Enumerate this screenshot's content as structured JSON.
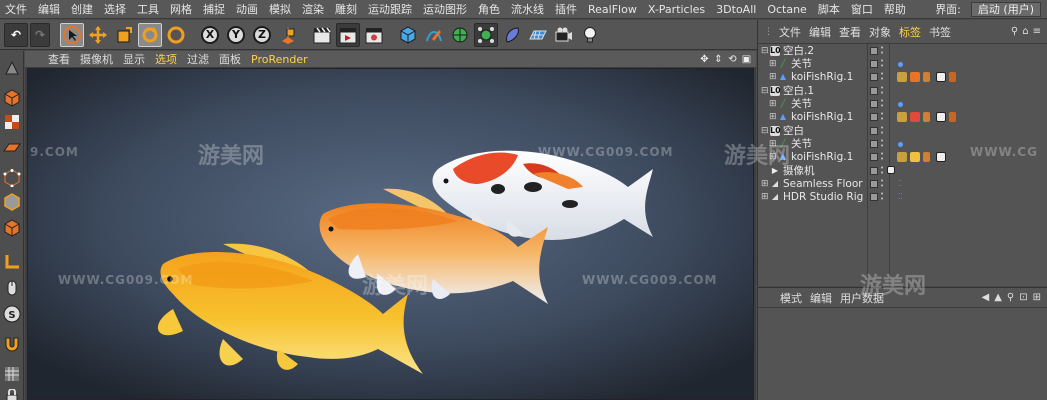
{
  "menubar": {
    "items": [
      "文件",
      "编辑",
      "创建",
      "选择",
      "工具",
      "网格",
      "捕捉",
      "动画",
      "模拟",
      "渲染",
      "雕刻",
      "运动跟踪",
      "运动图形",
      "角色",
      "流水线",
      "插件",
      "RealFlow",
      "X-Particles",
      "3DtoAll",
      "Octane",
      "脚本",
      "窗口",
      "帮助"
    ],
    "layout_label": "界面:",
    "layout_value": "启动 (用户)"
  },
  "toolbar": {
    "axis_x": "X",
    "axis_y": "Y",
    "axis_z": "Z"
  },
  "viewport": {
    "menu": [
      "查看",
      "摄像机",
      "显示",
      "选项",
      "过滤",
      "面板"
    ],
    "renderer": "ProRender"
  },
  "object_manager": {
    "tabs": [
      "文件",
      "编辑",
      "查看",
      "对象",
      "标签",
      "书签"
    ],
    "rows": [
      {
        "name": "空白.2"
      },
      {
        "name": "关节"
      },
      {
        "name": "koiFishRig.1"
      },
      {
        "name": "空白.1"
      },
      {
        "name": "关节"
      },
      {
        "name": "koiFishRig.1"
      },
      {
        "name": "空白"
      },
      {
        "name": "关节"
      },
      {
        "name": "koiFishRig.1"
      },
      {
        "name": "摄像机"
      },
      {
        "name": "Seamless Floor"
      },
      {
        "name": "HDR Studio Rig"
      }
    ]
  },
  "attribute_manager": {
    "tabs": [
      "模式",
      "编辑",
      "用户数据"
    ]
  },
  "watermarks": {
    "brand_cn": "游美网",
    "site": "WWW.CG009.COM",
    "site_short": "9.COM",
    "site_partial": "WWW.CG"
  },
  "colors": {
    "accent": "#ffd24a",
    "menubar": "#585858",
    "panel": "#545454"
  }
}
